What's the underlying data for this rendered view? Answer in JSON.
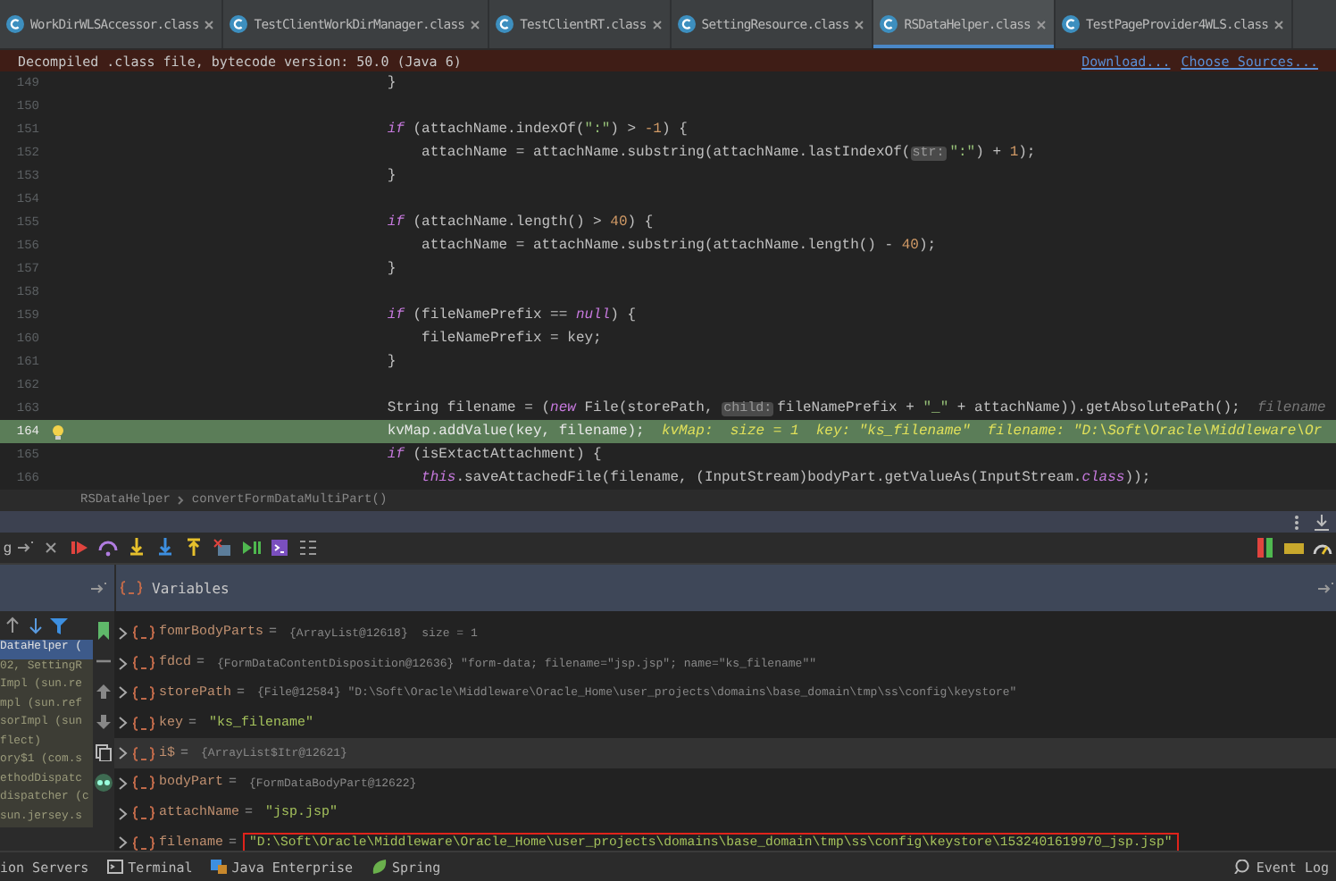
{
  "tabs": [
    {
      "label": "WorkDirWLSAccessor.class",
      "selected": false
    },
    {
      "label": "TestClientWorkDirManager.class",
      "selected": false
    },
    {
      "label": "TestClientRT.class",
      "selected": false
    },
    {
      "label": "SettingResource.class",
      "selected": false
    },
    {
      "label": "RSDataHelper.class",
      "selected": true
    },
    {
      "label": "TestPageProvider4WLS.class",
      "selected": false
    }
  ],
  "notice": {
    "text": "Decompiled .class file, bytecode version: 50.0 (Java 6)",
    "links": [
      "Download...",
      "Choose Sources..."
    ]
  },
  "code": [
    {
      "num": "149",
      "current": false,
      "segments": [
        {
          "kind": "plain",
          "text": "                                    }"
        }
      ]
    },
    {
      "num": "150",
      "current": false
    },
    {
      "num": "151",
      "current": false,
      "segments": [
        {
          "kind": "kw",
          "text": "                                    if"
        },
        {
          "kind": "plain",
          "text": " (attachName.indexOf("
        },
        {
          "kind": "str",
          "text": "\":\""
        },
        {
          "kind": "plain",
          "text": ") > "
        },
        {
          "kind": "num",
          "text": "-1"
        },
        {
          "kind": "plain",
          "text": ") {"
        }
      ]
    },
    {
      "num": "152",
      "current": false,
      "segments": [
        {
          "kind": "plain",
          "text": "                                        attachName = attachName.substring(attachName.lastIndexOf("
        },
        {
          "kind": "hint",
          "text": "str:"
        },
        {
          "kind": "str",
          "text": "\":\""
        },
        {
          "kind": "plain",
          "text": ") + "
        },
        {
          "kind": "num",
          "text": "1"
        },
        {
          "kind": "plain",
          "text": ");"
        }
      ]
    },
    {
      "num": "153",
      "current": false,
      "segments": [
        {
          "kind": "plain",
          "text": "                                    }"
        }
      ]
    },
    {
      "num": "154",
      "current": false
    },
    {
      "num": "155",
      "current": false,
      "segments": [
        {
          "kind": "kw",
          "text": "                                    if"
        },
        {
          "kind": "plain",
          "text": " (attachName.length() > "
        },
        {
          "kind": "num",
          "text": "40"
        },
        {
          "kind": "plain",
          "text": ") {"
        }
      ]
    },
    {
      "num": "156",
      "current": false,
      "segments": [
        {
          "kind": "plain",
          "text": "                                        attachName = attachName.substring(attachName.length() - "
        },
        {
          "kind": "num",
          "text": "40"
        },
        {
          "kind": "plain",
          "text": ");"
        }
      ]
    },
    {
      "num": "157",
      "current": false,
      "segments": [
        {
          "kind": "plain",
          "text": "                                    }"
        }
      ]
    },
    {
      "num": "158",
      "current": false
    },
    {
      "num": "159",
      "current": false,
      "segments": [
        {
          "kind": "kw",
          "text": "                                    if"
        },
        {
          "kind": "plain",
          "text": " (fileNamePrefix == "
        },
        {
          "kind": "kw",
          "text": "null"
        },
        {
          "kind": "plain",
          "text": ") {"
        }
      ]
    },
    {
      "num": "160",
      "current": false,
      "segments": [
        {
          "kind": "plain",
          "text": "                                        fileNamePrefix = key;"
        }
      ]
    },
    {
      "num": "161",
      "current": false,
      "segments": [
        {
          "kind": "plain",
          "text": "                                    }"
        }
      ]
    },
    {
      "num": "162",
      "current": false
    },
    {
      "num": "163",
      "current": false,
      "segments": [
        {
          "kind": "plain",
          "text": "                                    String filename = ("
        },
        {
          "kind": "kw",
          "text": "new"
        },
        {
          "kind": "plain",
          "text": " File(storePath, "
        },
        {
          "kind": "hint",
          "text": "child:"
        },
        {
          "kind": "plain",
          "text": "fileNamePrefix + "
        },
        {
          "kind": "str",
          "text": "\"_\""
        },
        {
          "kind": "plain",
          "text": " + attachName)).getAbsolutePath();  "
        },
        {
          "kind": "inlay",
          "text": "filename"
        }
      ]
    },
    {
      "num": "164",
      "current": true,
      "segments": [
        {
          "kind": "plain",
          "text": "                                    kvMap.addValue(key, filename);  "
        },
        {
          "kind": "value",
          "text": "kvMap:  size = 1  key: \"ks_filename\"  filename: \"D:\\Soft\\Oracle\\Middleware\\Or"
        }
      ]
    },
    {
      "num": "165",
      "current": false,
      "segments": [
        {
          "kind": "kw",
          "text": "                                    if"
        },
        {
          "kind": "plain",
          "text": " (isExtactAttachment) {"
        }
      ]
    },
    {
      "num": "166",
      "current": false,
      "segments": [
        {
          "kind": "kw",
          "text": "                                        this"
        },
        {
          "kind": "plain",
          "text": ".saveAttachedFile(filename, (InputStream)bodyPart.getValueAs(InputStream."
        },
        {
          "kind": "kw",
          "text": "class"
        },
        {
          "kind": "plain",
          "text": "));"
        }
      ]
    }
  ],
  "breadcrumbs": [
    "RSDataHelper",
    "convertFormDataMultiPart()"
  ],
  "debug_tab": {
    "label": "g"
  },
  "variables_title": "Variables",
  "frames": [
    {
      "text": "DataHelper (",
      "selected": true
    },
    {
      "text": "02, SettingR",
      "selected": false
    },
    {
      "text": "Impl (sun.re",
      "selected": false
    },
    {
      "text": "mpl (sun.ref",
      "selected": false
    },
    {
      "text": "sorImpl (sun",
      "selected": false
    },
    {
      "text": "flect)",
      "selected": false
    },
    {
      "text": "ory$1 (com.s",
      "selected": false
    },
    {
      "text": "ethodDispatc",
      "selected": false
    },
    {
      "text": "dispatcher (c",
      "selected": false
    },
    {
      "text": "sun.jersey.s",
      "selected": false
    }
  ],
  "variables": [
    {
      "name": "fomrBodyParts",
      "sign": "=",
      "kind": "object",
      "ref": "{ArrayList@12618}",
      "detail": " size = 1",
      "selected": false,
      "marked": false
    },
    {
      "name": "fdcd",
      "sign": "=",
      "kind": "object",
      "ref": "{FormDataContentDisposition@12636}",
      "detail": "\"form-data; filename=\"jsp.jsp\"; name=\"ks_filename\"\"",
      "selected": false,
      "marked": false
    },
    {
      "name": "storePath",
      "sign": "=",
      "kind": "object",
      "ref": "{File@12584}",
      "detail": "\"D:\\Soft\\Oracle\\Middleware\\Oracle_Home\\user_projects\\domains\\base_domain\\tmp\\ss\\config\\keystore\"",
      "selected": false,
      "marked": false
    },
    {
      "name": "key",
      "sign": "=",
      "kind": "string",
      "value": "\"ks_filename\"",
      "selected": false,
      "marked": false
    },
    {
      "name": "i$",
      "sign": "=",
      "kind": "object",
      "ref": "{ArrayList$Itr@12621}",
      "selected": true,
      "marked": false
    },
    {
      "name": "bodyPart",
      "sign": "=",
      "kind": "object",
      "ref": "{FormDataBodyPart@12622}",
      "selected": false,
      "marked": false
    },
    {
      "name": "attachName",
      "sign": "=",
      "kind": "string",
      "value": "\"jsp.jsp\"",
      "selected": false,
      "marked": false
    },
    {
      "name": "filename",
      "sign": "=",
      "kind": "string",
      "value": "\"D:\\Soft\\Oracle\\Middleware\\Oracle_Home\\user_projects\\domains\\base_domain\\tmp\\ss\\config\\keystore\\1532401619970_jsp.jsp\"",
      "selected": false,
      "marked": true
    }
  ],
  "bottom_tabs": [
    "ion Servers",
    "Terminal",
    "Java Enterprise",
    "Spring"
  ],
  "event_log": "Event Log"
}
